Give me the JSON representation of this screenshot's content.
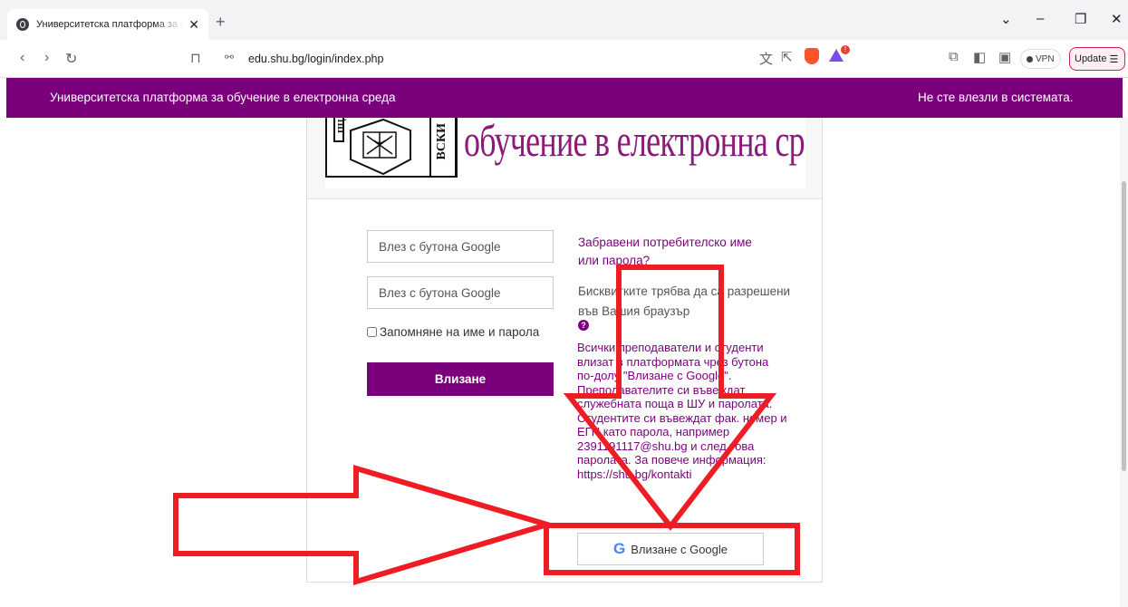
{
  "browser": {
    "tab_title": "Университетска платформа за обучение в електронна среда",
    "url": "edu.shu.bg/login/index.php",
    "vpn_label": "VPN",
    "update_label": "Update"
  },
  "header": {
    "site_title": "Университетска платформа за обучение в електронна среда",
    "login_status": "Не сте влезли в системата."
  },
  "banner": {
    "text": "обучение в електронна среда",
    "logo_text": "ВСКИ"
  },
  "login": {
    "username_placeholder": "Влез с бутона Google",
    "password_placeholder": "Влез с бутона Google",
    "remember_label": "Запомняне на име и парола",
    "login_button": "Влизане",
    "forgot_link": "Забравени потребителско име или парола?",
    "cookies_note": "Бисквитките трябва да са разрешени във Вашия браузър",
    "instructions": "Всички преподаватели и студенти влизат в платформата чрез бутона по-долу \"Влизане с Google\". Преподавателите си въвеждат служебната поща в ШУ и паролата. Студентите си въвеждат фак. номер и ЕГН като парола, например 2391191117@shu.bg и след това паролата. За повече информация: https://shu.bg/kontakti",
    "google_button": "Влизане с Google"
  },
  "annotation": {
    "color": "#ee1c24"
  }
}
